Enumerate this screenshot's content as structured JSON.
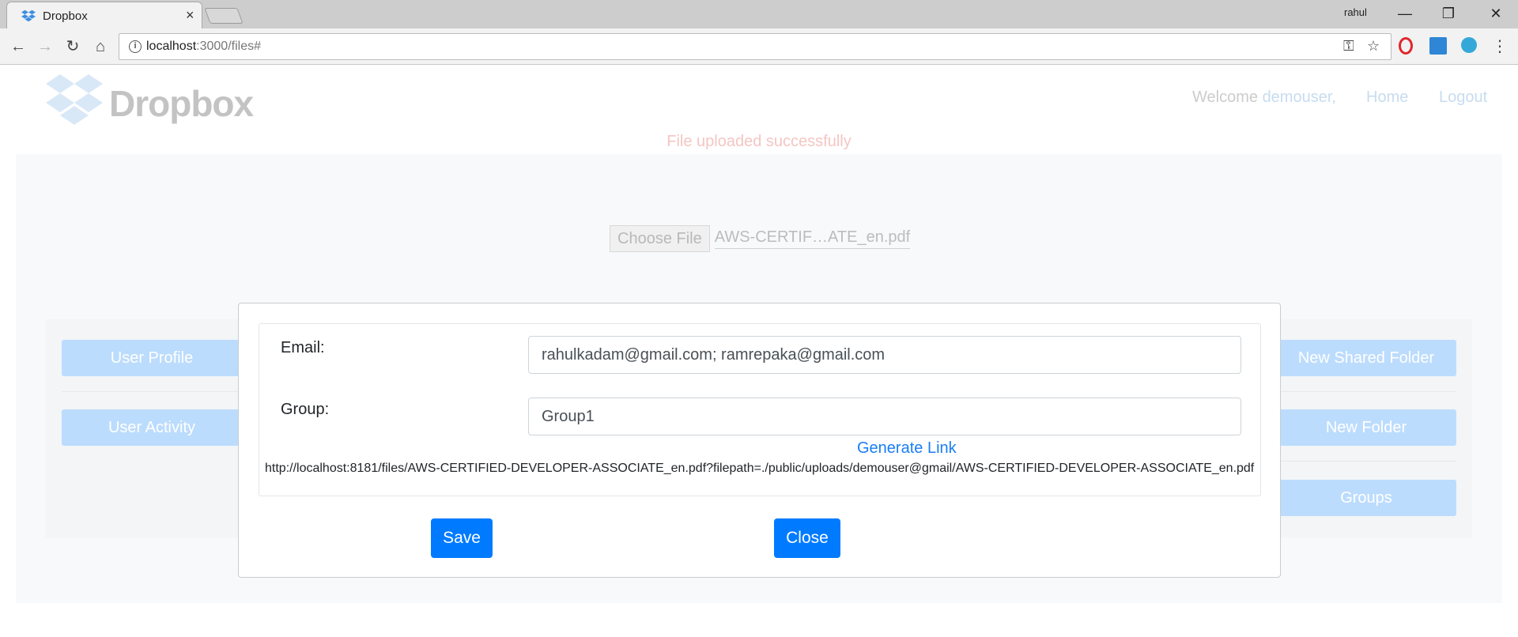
{
  "browser": {
    "tab_title": "Dropbox",
    "tab_close": "×",
    "profile_name": "rahul",
    "url_host": "localhost",
    "url_rest": ":3000/files#"
  },
  "header": {
    "logo_text": "Dropbox",
    "welcome_label": "Welcome",
    "username": "demouser,",
    "home_label": "Home",
    "logout_label": "Logout"
  },
  "status_message": "File uploaded successfully",
  "upload": {
    "choose_file_label": "Choose File",
    "selected_file": "AWS-CERTIF…ATE_en.pdf"
  },
  "left_menu": [
    "User Profile",
    "User Activity"
  ],
  "right_menu": [
    "New Shared Folder",
    "New Folder",
    "Groups"
  ],
  "share_modal": {
    "email_label": "Email:",
    "email_value": "rahulkadam@gmail.com; ramrepaka@gmail.com",
    "group_label": "Group:",
    "group_value": "Group1",
    "generate_link_label": "Generate Link",
    "generated_link": "http://localhost:8181/files/AWS-CERTIFIED-DEVELOPER-ASSOCIATE_en.pdf?filepath=./public/uploads/demouser@gmail/AWS-CERTIFIED-DEVELOPER-ASSOCIATE_en.pdf",
    "save_label": "Save",
    "close_label": "Close"
  },
  "colors": {
    "primary_button": "#007bff",
    "link_blue": "#1a7ef5",
    "faded_menu_button": "#bcdcfd",
    "success_message_faded": "#f4c6c3"
  },
  "icons": [
    "dropbox-favicon-icon",
    "back-arrow-icon",
    "forward-arrow-icon",
    "reload-icon",
    "home-icon",
    "info-icon",
    "key-icon",
    "star-icon",
    "opera-extension-icon",
    "window-extension-icon",
    "globe-extension-icon",
    "menu-kebab-icon",
    "minimize-icon",
    "restore-icon",
    "close-window-icon",
    "dropbox-logo-icon"
  ]
}
